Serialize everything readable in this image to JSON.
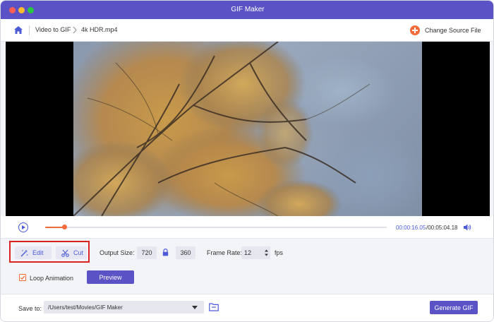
{
  "window": {
    "title": "GIF Maker"
  },
  "nav": {
    "home_icon": "home-icon",
    "breadcrumb": [
      "Video to GIF",
      "4k HDR.mp4"
    ],
    "change_source_label": "Change Source File"
  },
  "player": {
    "current_time": "00:00:16.05",
    "total_time": "/00:05:04.18",
    "progress": 0.056
  },
  "tools": {
    "edit_label": "Edit",
    "cut_label": "Cut"
  },
  "output": {
    "size_label": "Output Size:",
    "width": "720",
    "height": "360",
    "frame_rate_label": "Frame Rate:",
    "frame_rate": "12",
    "fps_unit": "fps"
  },
  "options": {
    "loop_label": "Loop Animation",
    "loop_checked": true,
    "preview_label": "Preview"
  },
  "save": {
    "label": "Save to:",
    "path": "/Users/test/Movies/GIF Maker",
    "generate_label": "Generate GIF"
  },
  "colors": {
    "accent": "#5b52c6",
    "progress": "#f26b3a",
    "highlight": "#d8231f"
  }
}
